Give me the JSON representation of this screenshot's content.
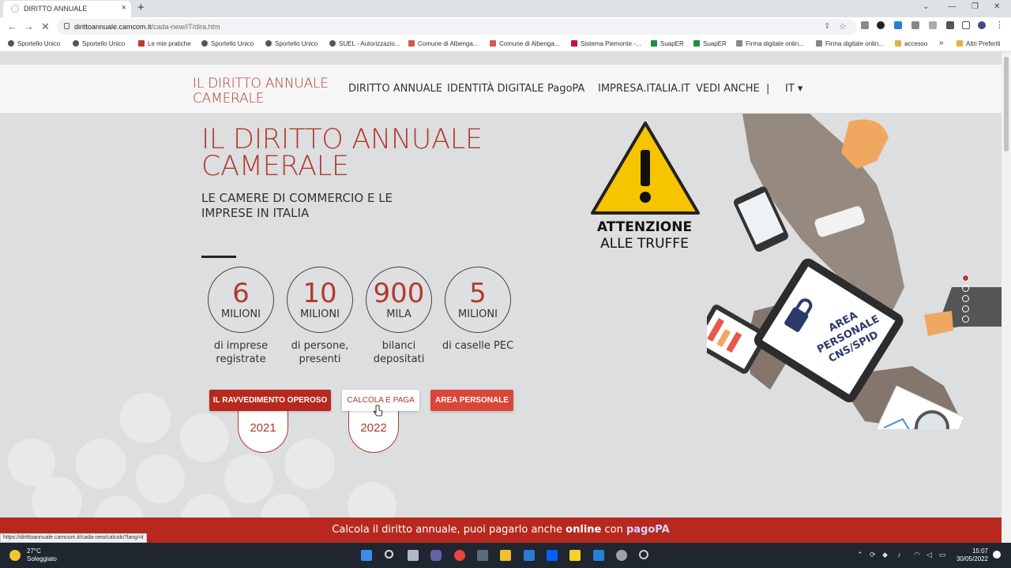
{
  "browser": {
    "tab_title": "DIRITTO ANNUALE",
    "tab_close": "×",
    "new_tab": "+",
    "url_host": "dirittoannuale.camcom.it",
    "url_path": "/cada-new/IT/dira.htm",
    "status_url": "https://dirittoannuale.camcom.it/cada-new/calcolo?lang=it",
    "bookmarks": [
      "Sportello Unico",
      "Sportello Unico",
      "Le mie pratiche",
      "Sportello Unico",
      "Sportello Unico",
      "SUEL - Autorizzazio...",
      "Comune di Albenga...",
      "Comune di Albenga...",
      "Sistema Piemonte -...",
      "SuapER",
      "SuapER",
      "Firma digitale onlin...",
      "Firma digitale onlin...",
      "accesso"
    ],
    "bookmarks_more": "»",
    "other_bookmarks": "Altri Preferiti"
  },
  "site": {
    "logo": "IL DIRITTO ANNUALE CAMERALE",
    "menu": [
      "DIRITTO ANNUALE",
      "IDENTITÀ DIGITALE",
      "PagoPA",
      "IMPRESA.ITALIA.IT",
      "VEDI ANCHE",
      "|",
      "IT ▾"
    ]
  },
  "hero": {
    "title": "IL DIRITTO ANNUALE CAMERALE",
    "subtitle": "LE CAMERE DI COMMERCIO E LE IMPRESE IN ITALIA",
    "stats": [
      {
        "num": "6",
        "unit": "MILIONI",
        "label": "di imprese registrate"
      },
      {
        "num": "10",
        "unit": "MILIONI",
        "label": "di persone, presenti"
      },
      {
        "num": "900",
        "unit": "MILA",
        "label": "bilanci depositati"
      },
      {
        "num": "5",
        "unit": "MILIONI",
        "label": "di caselle PEC"
      }
    ],
    "buttons": {
      "ravvedimento": "IL RAVVEDIMENTO OPEROSO",
      "calcola": "CALCOLA E PAGA",
      "area": "AREA PERSONALE"
    },
    "years": [
      "2021",
      "2022"
    ]
  },
  "warning": {
    "line1": "ATTENZIONE",
    "line2": "ALLE TRUFFE"
  },
  "illustration": {
    "tablet_text": "AREA PERSONALE CNS/SPID"
  },
  "banner": {
    "text": "Calcola il diritto annuale, puoi pagarlo anche ",
    "bold": "online",
    "con": " con ",
    "pago": "pagoPA"
  },
  "taskbar": {
    "temp": "27°C",
    "weather": "Soleggiato",
    "time": "15:07",
    "date": "30/05/2022"
  },
  "colors": {
    "brand_red": "#b23a2e",
    "banner_red": "#b7281e",
    "button_red": "#d9473a"
  }
}
